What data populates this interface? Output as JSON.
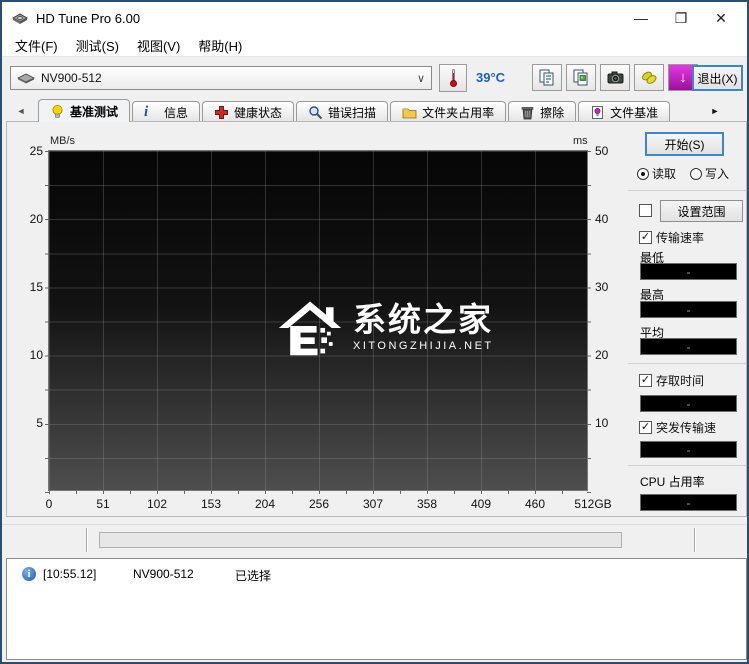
{
  "window": {
    "title": "HD Tune Pro 6.00"
  },
  "icons": {
    "minimize": "—",
    "maximize": "❐",
    "close": "✕",
    "combo_arrow": "∨",
    "scroll_left": "◄",
    "scroll_right": "►",
    "check": "✓",
    "download_arrow": "↓",
    "info_letter": "i",
    "log_info": "i"
  },
  "menu": {
    "items": [
      "文件(F)",
      "测试(S)",
      "视图(V)",
      "帮助(H)"
    ]
  },
  "toolbar": {
    "device_selector": {
      "value": "NV900-512"
    },
    "temperature": "39°C",
    "exit_button": "退出(X)"
  },
  "tabs": {
    "active": "基准测试",
    "items": [
      {
        "label": "基准测试",
        "icon": "lightbulb-icon"
      },
      {
        "label": "信息",
        "icon": "info-icon"
      },
      {
        "label": "健康状态",
        "icon": "health-cross-icon"
      },
      {
        "label": "错误扫描",
        "icon": "magnifier-icon"
      },
      {
        "label": "文件夹占用率",
        "icon": "folder-icon"
      },
      {
        "label": "擦除",
        "icon": "trash-icon"
      },
      {
        "label": "文件基准",
        "icon": "file-benchmark-icon"
      }
    ]
  },
  "chart_data": {
    "type": "line",
    "title": "HD Tune benchmark graph (no test run yet)",
    "series": [],
    "left_axis": {
      "label": "MB/s",
      "ticks": [
        "25",
        "20",
        "15",
        "10",
        "5"
      ],
      "range": [
        0,
        25
      ]
    },
    "right_axis": {
      "label": "ms",
      "ticks": [
        "50",
        "40",
        "30",
        "20",
        "10"
      ],
      "range": [
        0,
        50
      ]
    },
    "x_axis": {
      "ticks": [
        "0",
        "51",
        "102",
        "153",
        "204",
        "256",
        "307",
        "358",
        "409",
        "460",
        "512GB"
      ],
      "range_gb": [
        0,
        512
      ]
    },
    "grid": "on",
    "watermark": {
      "title": "系统之家",
      "subtitle": "XITONGZHIJIA.NET"
    }
  },
  "panel": {
    "start_button": "开始(S)",
    "read_radio": "读取",
    "write_radio": "写入",
    "read_selected": true,
    "set_range_button": "设置范围",
    "transfer_rate": {
      "label": "传输速率",
      "checked": true,
      "min_label": "最低",
      "max_label": "最高",
      "avg_label": "平均",
      "min": "-",
      "max": "-",
      "avg": "-"
    },
    "access_time": {
      "label": "存取时间",
      "checked": true,
      "value": "-"
    },
    "burst_rate": {
      "label": "突发传输速",
      "checked": true,
      "value": "-"
    },
    "cpu_usage": {
      "label": "CPU 占用率",
      "value": "-"
    }
  },
  "log": {
    "entries": [
      {
        "time": "[10:55.12]",
        "device": "NV900-512",
        "message": "已选择"
      }
    ]
  }
}
